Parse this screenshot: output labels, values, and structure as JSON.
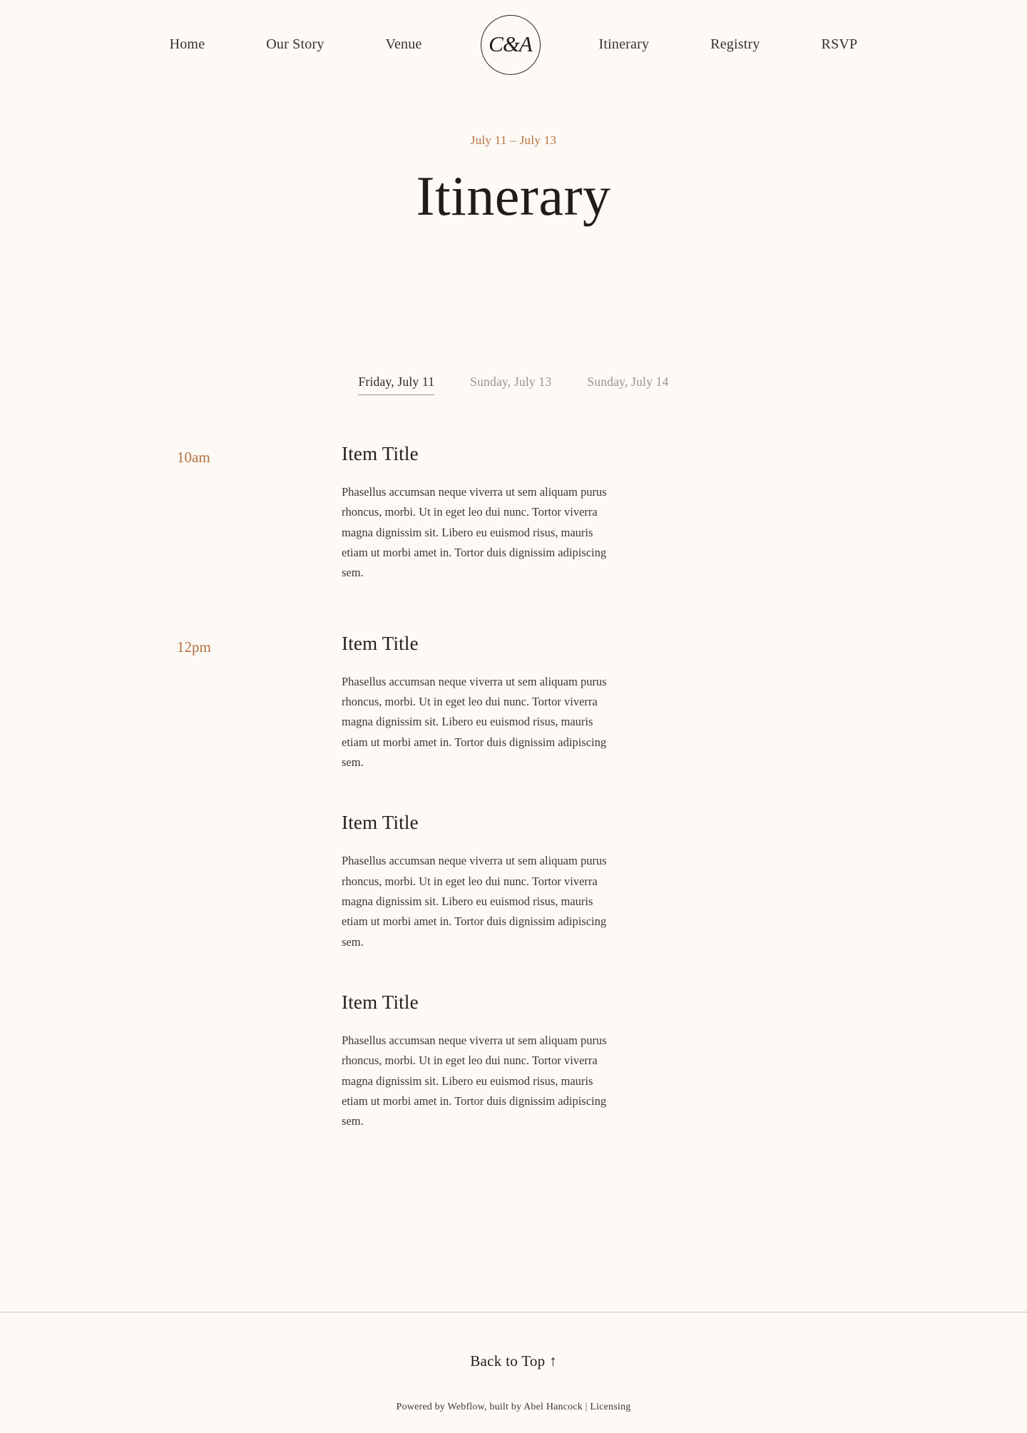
{
  "theme": {
    "background": "#FDF9F5",
    "text": "#2B2320",
    "accent": "#B5703F",
    "muted": "#9A938D",
    "rule": "#C9C5C0"
  },
  "nav": {
    "logo_text": "C&A",
    "left_links": [
      {
        "label": "Home"
      },
      {
        "label": "Our Story"
      },
      {
        "label": "Venue"
      }
    ],
    "right_links": [
      {
        "label": "Itinerary"
      },
      {
        "label": "Registry"
      },
      {
        "label": "RSVP"
      }
    ]
  },
  "hero": {
    "eyebrow": "July 11 – July 13",
    "title": "Itinerary"
  },
  "tabs": [
    {
      "label": "Friday, July 11",
      "active": true
    },
    {
      "label": "Sunday, July 13",
      "active": false
    },
    {
      "label": "Sunday, July 14",
      "active": false
    }
  ],
  "schedule": [
    {
      "time": "10am",
      "items": [
        {
          "title": "Item Title",
          "body": "Phasellus accumsan neque viverra ut sem aliquam purus rhoncus, morbi. Ut in eget leo dui nunc. Tortor viverra magna dignissim sit. Libero eu euismod risus, mauris etiam ut morbi amet in. Tortor duis dignissim adipiscing sem."
        }
      ]
    },
    {
      "time": "12pm",
      "items": [
        {
          "title": "Item Title",
          "body": "Phasellus accumsan neque viverra ut sem aliquam purus rhoncus, morbi. Ut in eget leo dui nunc. Tortor viverra magna dignissim sit. Libero eu euismod risus, mauris etiam ut morbi amet in. Tortor duis dignissim adipiscing sem."
        },
        {
          "title": "Item Title",
          "body": "Phasellus accumsan neque viverra ut sem aliquam purus rhoncus, morbi. Ut in eget leo dui nunc. Tortor viverra magna dignissim sit. Libero eu euismod risus, mauris etiam ut morbi amet in. Tortor duis dignissim adipiscing sem."
        },
        {
          "title": "Item Title",
          "body": "Phasellus accumsan neque viverra ut sem aliquam purus rhoncus, morbi. Ut in eget leo dui nunc. Tortor viverra magna dignissim sit. Libero eu euismod risus, mauris etiam ut morbi amet in. Tortor duis dignissim adipiscing sem."
        }
      ]
    }
  ],
  "footer": {
    "back_to_top": "Back to Top ↑",
    "credit_prefix": "Powered by ",
    "credit_webflow": "Webflow",
    "credit_middle": ", built by ",
    "credit_author": "Abel Hancock",
    "credit_separator": " | ",
    "credit_licensing": "Licensing"
  }
}
